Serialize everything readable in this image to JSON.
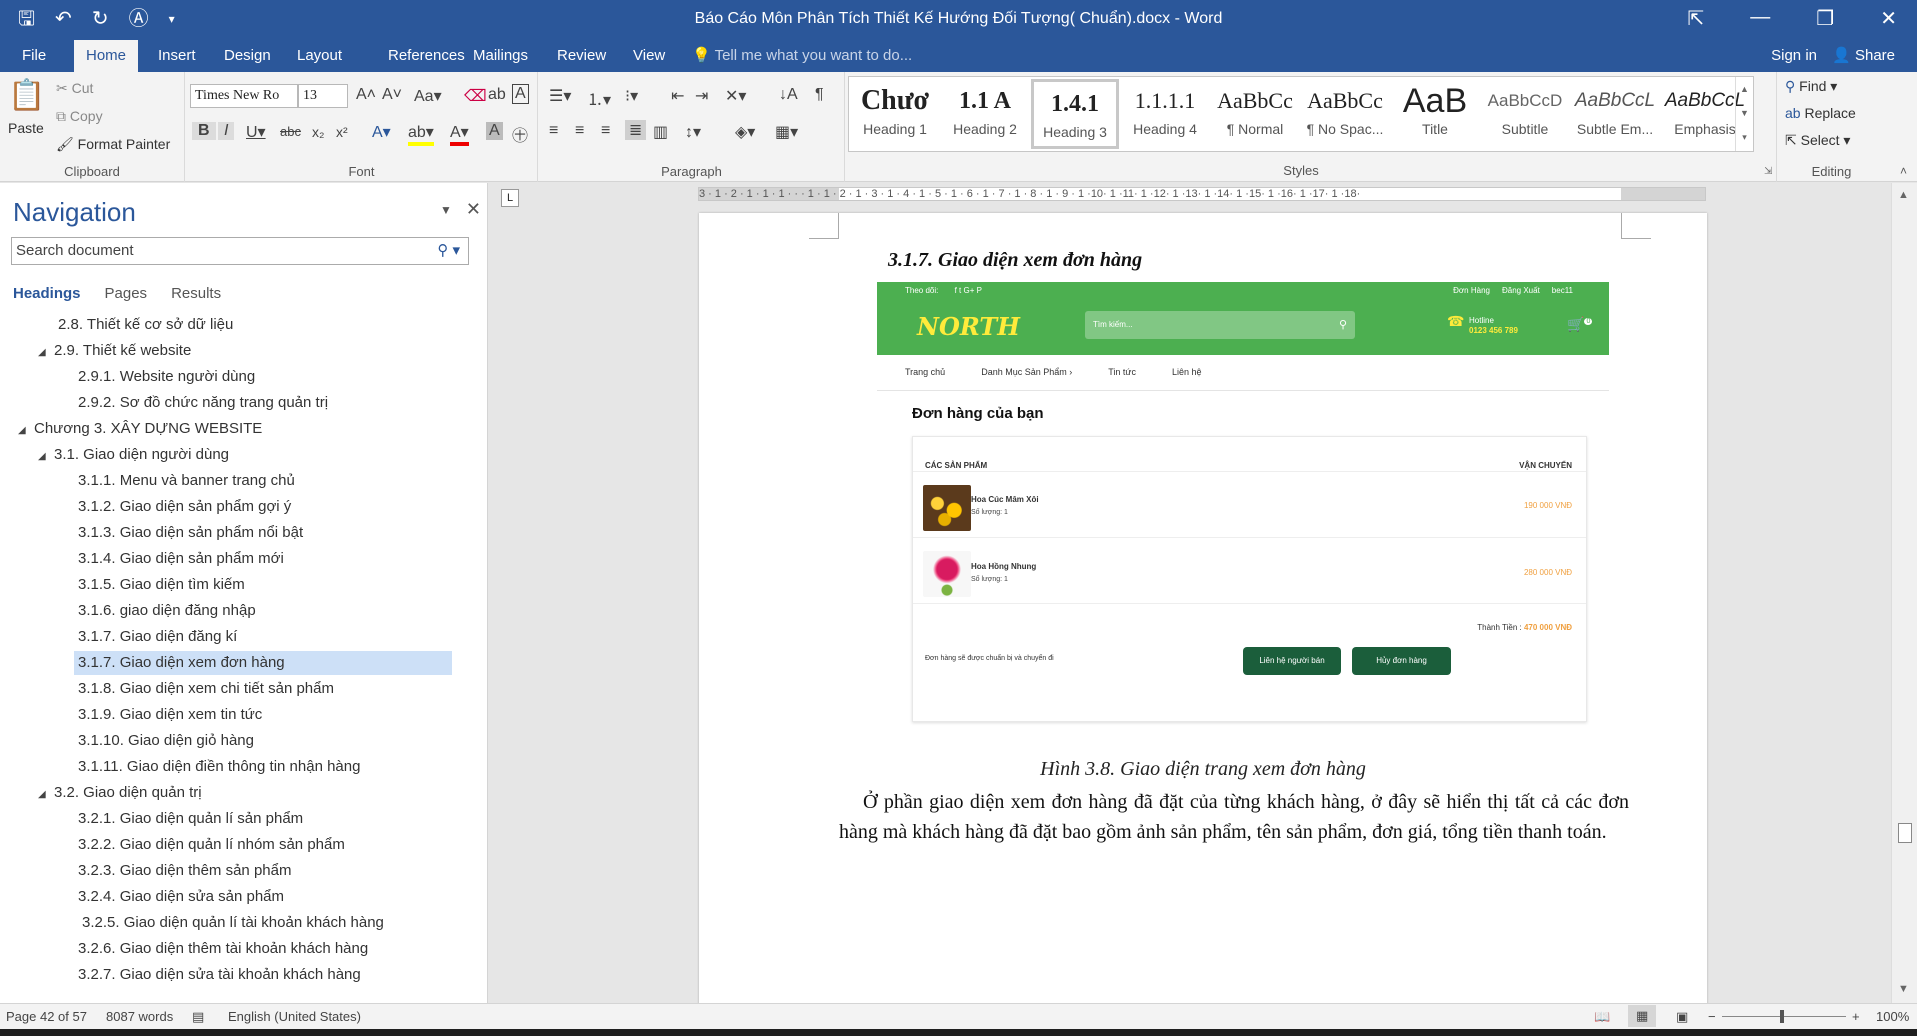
{
  "window": {
    "title": "Báo Cáo Môn Phân Tích Thiết Kế Hướng Đối Tượng( Chuẩn).docx - Word",
    "qat_icons": [
      "save-icon",
      "undo-icon",
      "redo-icon",
      "format-icon",
      "customize-icon"
    ]
  },
  "tabs": [
    "File",
    "Home",
    "Insert",
    "Design",
    "Layout",
    "References",
    "Mailings",
    "Review",
    "View"
  ],
  "tell_me": "Tell me what you want to do...",
  "signin": "Sign in",
  "share": "Share",
  "ribbon": {
    "clipboard": {
      "label": "Clipboard",
      "paste": "Paste",
      "cut": "Cut",
      "copy": "Copy",
      "format_painter": "Format Painter"
    },
    "font": {
      "label": "Font",
      "family": "Times New Ro",
      "size": "13"
    },
    "paragraph": {
      "label": "Paragraph"
    },
    "styles": {
      "label": "Styles",
      "items": [
        {
          "preview": "Chươ",
          "name": "Heading 1"
        },
        {
          "preview": "1.1 A",
          "name": "Heading 2"
        },
        {
          "preview": "1.4.1",
          "name": "Heading 3"
        },
        {
          "preview": "1.1.1.1",
          "name": "Heading 4"
        },
        {
          "preview": "AaBbCc",
          "name": "¶ Normal"
        },
        {
          "preview": "AaBbCc",
          "name": "¶ No Spac..."
        },
        {
          "preview": "AaB",
          "name": "Title"
        },
        {
          "preview": "AaBbCcD",
          "name": "Subtitle"
        },
        {
          "preview": "AaBbCcL",
          "name": "Subtle Em..."
        },
        {
          "preview": "AaBbCcL",
          "name": "Emphasis"
        }
      ]
    },
    "editing": {
      "label": "Editing",
      "find": "Find",
      "replace": "Replace",
      "select": "Select"
    }
  },
  "navigation": {
    "title": "Navigation",
    "search_placeholder": "Search document",
    "tabs": [
      "Headings",
      "Pages",
      "Results"
    ],
    "items": [
      "2.8. Thiết kế cơ sở dữ liệu",
      "2.9. Thiết kế website",
      "2.9.1. Website người dùng",
      "2.9.2. Sơ đồ chức năng trang quản trị",
      "Chương 3. XÂY DỰNG WEBSITE",
      "3.1. Giao diện người dùng",
      "3.1.1. Menu và banner trang chủ",
      "3.1.2. Giao diện sản phẩm gợi ý",
      "3.1.3. Giao diện sản phẩm nổi bật",
      "3.1.4. Giao diện sản phẩm mới",
      "3.1.5. Giao diện tìm kiếm",
      "3.1.6. giao diện đăng nhập",
      "3.1.7. Giao diện đăng kí",
      "3.1.7. Giao diện xem đơn hàng",
      "3.1.8. Giao diện xem chi tiết sản phẩm",
      "3.1.9. Giao diện xem tin tức",
      "3.1.10. Giao diện giỏ hàng",
      "3.1.11. Giao diện điền thông tin nhận hàng",
      "3.2. Giao diện quản trị",
      "3.2.1. Giao diện quản lí sản phẩm",
      "3.2.2. Giao diện quản lí nhóm sản phẩm",
      "3.2.3. Giao diện thêm sản phẩm",
      "3.2.4. Giao diện sửa sản phẩm",
      "3.2.5. Giao diện quản lí tài khoản khách hàng",
      "3.2.6. Giao diện thêm tài khoản khách hàng",
      "3.2.7. Giao diện sửa tài khoản khách hàng"
    ]
  },
  "ruler": "3 · 1 · 2 · 1 · 1 · 1 · · · 1 · 1 · 2 · 1 · 3 · 1 · 4 · 1 · 5 · 1 · 6 · 1 · 7 · 1 · 8 · 1 · 9 · 1 ·10· 1 ·11· 1 ·12· 1 ·13· 1 ·14· 1 ·15· 1 ·16· 1 ·17· 1 ·18·",
  "document": {
    "heading": "3.1.7. Giao diện xem đơn hàng",
    "caption": "Hình 3.8. Giao diện trang xem đơn hàng",
    "body": "Ở phần giao diện xem đơn hàng đã đặt của từng khách hàng, ở đây sẽ hiển thị tất cả các đơn hàng mà khách hàng đã đặt bao gồm ảnh sản phẩm, tên sản phẩm, đơn giá, tổng tiền thanh toán."
  },
  "shot": {
    "follow": "Theo dõi:",
    "social": "f  t  G+  P",
    "top_links": [
      "Đơn Hàng",
      "Đăng Xuất",
      "bec11"
    ],
    "logo": "NORTH",
    "search_placeholder": "Tìm kiếm...",
    "hotline_label": "Hotline",
    "hotline_number": "0123 456 789",
    "cart_count": "0",
    "menu": [
      "Trang chủ",
      "Danh Mục Sản Phẩm ›",
      "Tin tức",
      "Liên hệ"
    ],
    "orders_title": "Đơn hàng của bạn",
    "col_products": "CÁC SẢN PHẨM",
    "col_shipping": "VẬN CHUYỂN",
    "products": [
      {
        "name": "Hoa Cúc Mâm Xôi",
        "qty": "Số lượng: 1",
        "price": "190 000 VNĐ"
      },
      {
        "name": "Hoa Hồng Nhung",
        "qty": "Số lượng: 1",
        "price": "280 000 VNĐ"
      }
    ],
    "total_label": "Thành Tiền :",
    "total_value": "470 000 VNĐ",
    "note": "Đơn hàng sẽ được chuẩn bị và chuyển đi",
    "contact_button": "Liên hệ người bán",
    "cancel_button": "Hủy đơn hàng"
  },
  "status": {
    "page": "Page 42 of 57",
    "words": "8087 words",
    "language": "English (United States)",
    "zoom": "100%"
  }
}
